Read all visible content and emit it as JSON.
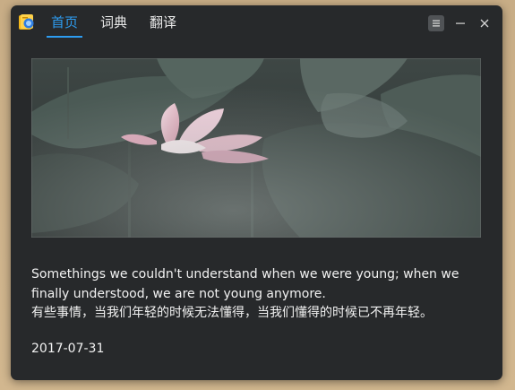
{
  "tabs": [
    {
      "label": "首页",
      "active": true
    },
    {
      "label": "词典",
      "active": false
    },
    {
      "label": "翻译",
      "active": false
    }
  ],
  "window_controls": {
    "menu_icon": "hamburger-menu-icon",
    "minimize_icon": "minimize-icon",
    "close_icon": "close-icon"
  },
  "accent_color": "#2d9cf0",
  "daily_sentence": {
    "english": "Somethings we couldn't understand when we were young; when we finally understood, we are not young anymore.",
    "chinese": "有些事情，当我们年轻的时候无法懂得，当我们懂得的时候已不再年轻。",
    "date": "2017-07-31"
  }
}
